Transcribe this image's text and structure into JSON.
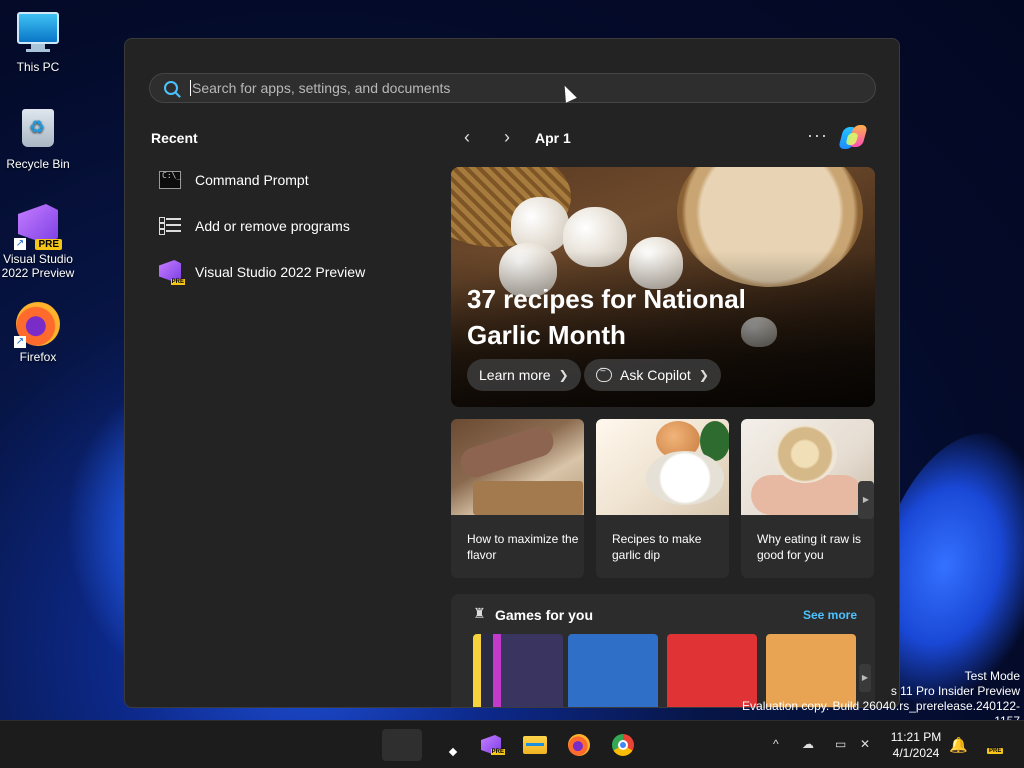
{
  "desktop": {
    "icons": [
      {
        "label": "This PC"
      },
      {
        "label": "Recycle Bin"
      },
      {
        "label": "Visual Studio 2022 Preview"
      },
      {
        "label": "Firefox"
      }
    ],
    "badge_pre": "PRE"
  },
  "start_menu": {
    "search": {
      "placeholder": "Search for apps, settings, and documents"
    },
    "recent": {
      "title": "Recent",
      "items": [
        {
          "label": "Command Prompt",
          "icon": "command-prompt-icon"
        },
        {
          "label": "Add or remove programs",
          "icon": "list-settings-icon"
        },
        {
          "label": "Visual Studio 2022 Preview",
          "icon": "visual-studio-icon"
        }
      ]
    },
    "feed": {
      "prev": "‹",
      "next": "›",
      "date": "Apr 1",
      "more": "···",
      "hero": {
        "headline": "37 recipes for National Garlic Month",
        "learn_more": "Learn more",
        "ask_copilot": "Ask Copilot"
      },
      "cards": [
        {
          "caption": "How to maximize the flavor"
        },
        {
          "caption": "Recipes to make garlic dip"
        },
        {
          "caption": "Why eating it raw is good for you"
        }
      ],
      "games": {
        "title": "Games for you",
        "see_more": "See more"
      }
    }
  },
  "watermark": {
    "line1": "Test Mode",
    "line2": "s 11 Pro Insider Preview",
    "line3": "Evaluation copy. Build 26040.rs_prerelease.240122-1157"
  },
  "taskbar": {
    "pre": "PRE",
    "tray_up": "^",
    "clock": {
      "time": "11:21 PM",
      "date": "4/1/2024"
    }
  },
  "colors": {
    "accent": "#4cc2ff",
    "panel": "#232323",
    "badge": "#f5c518"
  }
}
